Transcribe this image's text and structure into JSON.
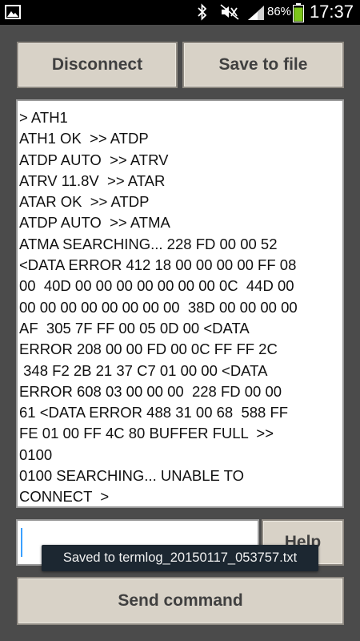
{
  "status_bar": {
    "battery_percent": "86%",
    "time": "17:37",
    "icons": [
      "gallery-icon",
      "bluetooth-icon",
      "mute-icon",
      "signal-icon",
      "battery-icon"
    ]
  },
  "buttons": {
    "disconnect": "Disconnect",
    "save_to_file": "Save to file",
    "help": "Help",
    "send_command": "Send command"
  },
  "terminal": {
    "log": "> ATH1\nATH1 OK  >> ATDP\nATDP AUTO  >> ATRV\nATRV 11.8V  >> ATAR\nATAR OK  >> ATDP\nATDP AUTO  >> ATMA\nATMA SEARCHING... 228 FD 00 00 52\n<DATA ERROR 412 18 00 00 00 00 FF 08\n00  40D 00 00 00 00 00 00 00 0C  44D 00\n00 00 00 00 00 00 00 00  38D 00 00 00 00\nAF  305 7F FF 00 05 0D 00 <DATA\nERROR 208 00 00 FD 00 0C FF FF 2C\n 348 F2 2B 21 37 C7 01 00 00 <DATA\nERROR 608 03 00 00 00  228 FD 00 00\n61 <DATA ERROR 488 31 00 68  588 FF\nFE 01 00 FF 4C 80 BUFFER FULL  >>\n0100\n0100 SEARCHING... UNABLE TO\nCONNECT  >"
  },
  "command_input": {
    "value": ""
  },
  "toast": {
    "message": "Saved to termlog_20150117_053757.txt"
  },
  "colors": {
    "background": "#4b4b4b",
    "button_face": "#d8d2c7",
    "button_text": "#404040",
    "toast_bg": "#1c2731",
    "caret": "#3aa0ff"
  }
}
